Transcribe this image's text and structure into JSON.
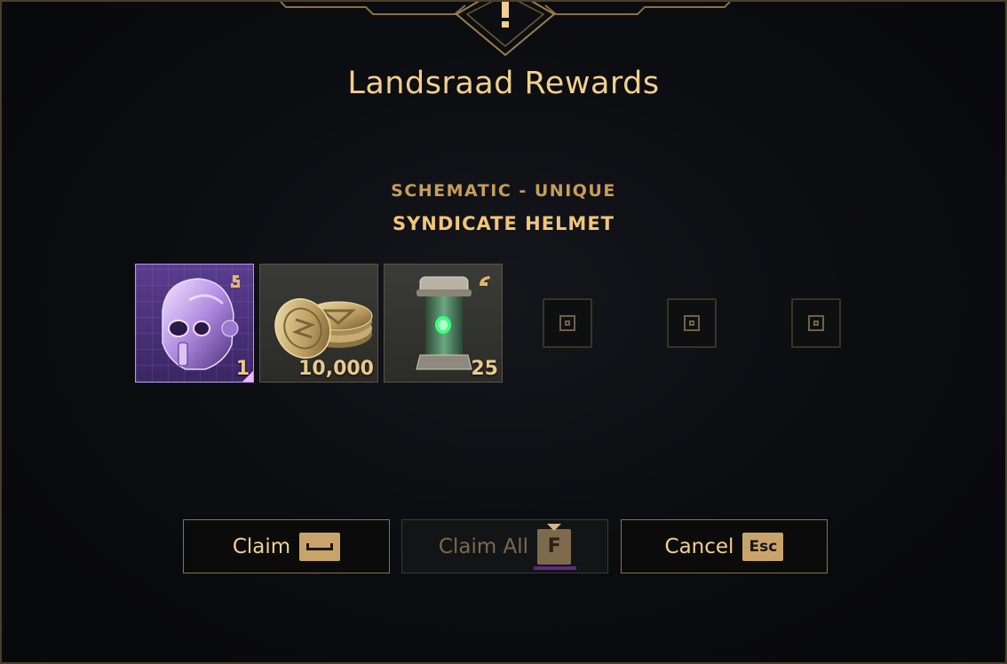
{
  "header": {
    "crest_icon": "exclamation-icon",
    "title": "Landsraad Rewards"
  },
  "reward": {
    "category": "SCHEMATIC - UNIQUE",
    "name": "SYNDICATE HELMET"
  },
  "slots": [
    {
      "icon": "helmet-icon",
      "quantity": "1",
      "rarity_color": "#b497e8"
    },
    {
      "icon": "coins-icon",
      "quantity": "10,000"
    },
    {
      "icon": "tube-icon",
      "quantity": "25"
    }
  ],
  "empty_slot_icon": "empty-slot-icon",
  "buttons": {
    "claim": {
      "label": "Claim",
      "key_icon": "spacebar-key-icon"
    },
    "claim_all": {
      "label": "Claim All",
      "key": "F"
    },
    "cancel": {
      "label": "Cancel",
      "key": "Esc"
    }
  },
  "colors": {
    "gold": "#f2cf8c",
    "border": "#8a7445",
    "accent_purple": "#5b2a88"
  }
}
